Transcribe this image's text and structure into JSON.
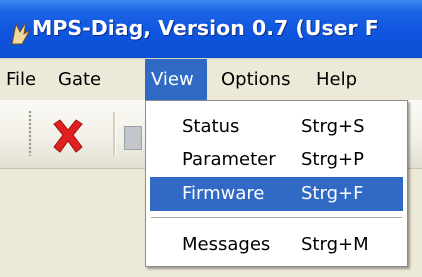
{
  "window": {
    "title": "MPS-Diag, Version 0.7 (User F"
  },
  "menubar": {
    "items": [
      {
        "label": "File"
      },
      {
        "label": "Gate"
      },
      {
        "label": "View"
      },
      {
        "label": "Options"
      },
      {
        "label": "Help"
      }
    ]
  },
  "view_menu": {
    "items": [
      {
        "label": "Status",
        "shortcut": "Strg+S"
      },
      {
        "label": "Parameter",
        "shortcut": "Strg+P"
      },
      {
        "label": "Firmware",
        "shortcut": "Strg+F"
      },
      {
        "label": "Messages",
        "shortcut": "Strg+M"
      }
    ]
  },
  "toolbar": {
    "icons": [
      "close-icon",
      "document-icon"
    ]
  },
  "colors": {
    "titlebar": "#0c4fd3",
    "menu_highlight": "#316ac5",
    "menubar_bg": "#ece9d8",
    "close_red": "#e02020"
  }
}
